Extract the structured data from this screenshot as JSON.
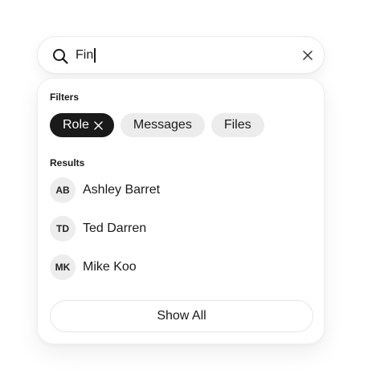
{
  "search": {
    "value": "Fin",
    "icon": "search-icon",
    "clear_icon": "close-icon"
  },
  "filters": {
    "label": "Filters",
    "chips": [
      {
        "label": "Role",
        "active": true,
        "remove_icon": "close-icon"
      },
      {
        "label": "Messages",
        "active": false
      },
      {
        "label": "Files",
        "active": false
      }
    ]
  },
  "results": {
    "label": "Results",
    "items": [
      {
        "initials": "AB",
        "name": "Ashley Barret"
      },
      {
        "initials": "TD",
        "name": "Ted Darren"
      },
      {
        "initials": "MK",
        "name": "Mike Koo"
      }
    ]
  },
  "show_all_label": "Show All",
  "colors": {
    "accent": "#1a1a1a",
    "chip_bg": "#ececec",
    "avatar_bg": "#ededed",
    "border": "#e6e6e6"
  }
}
